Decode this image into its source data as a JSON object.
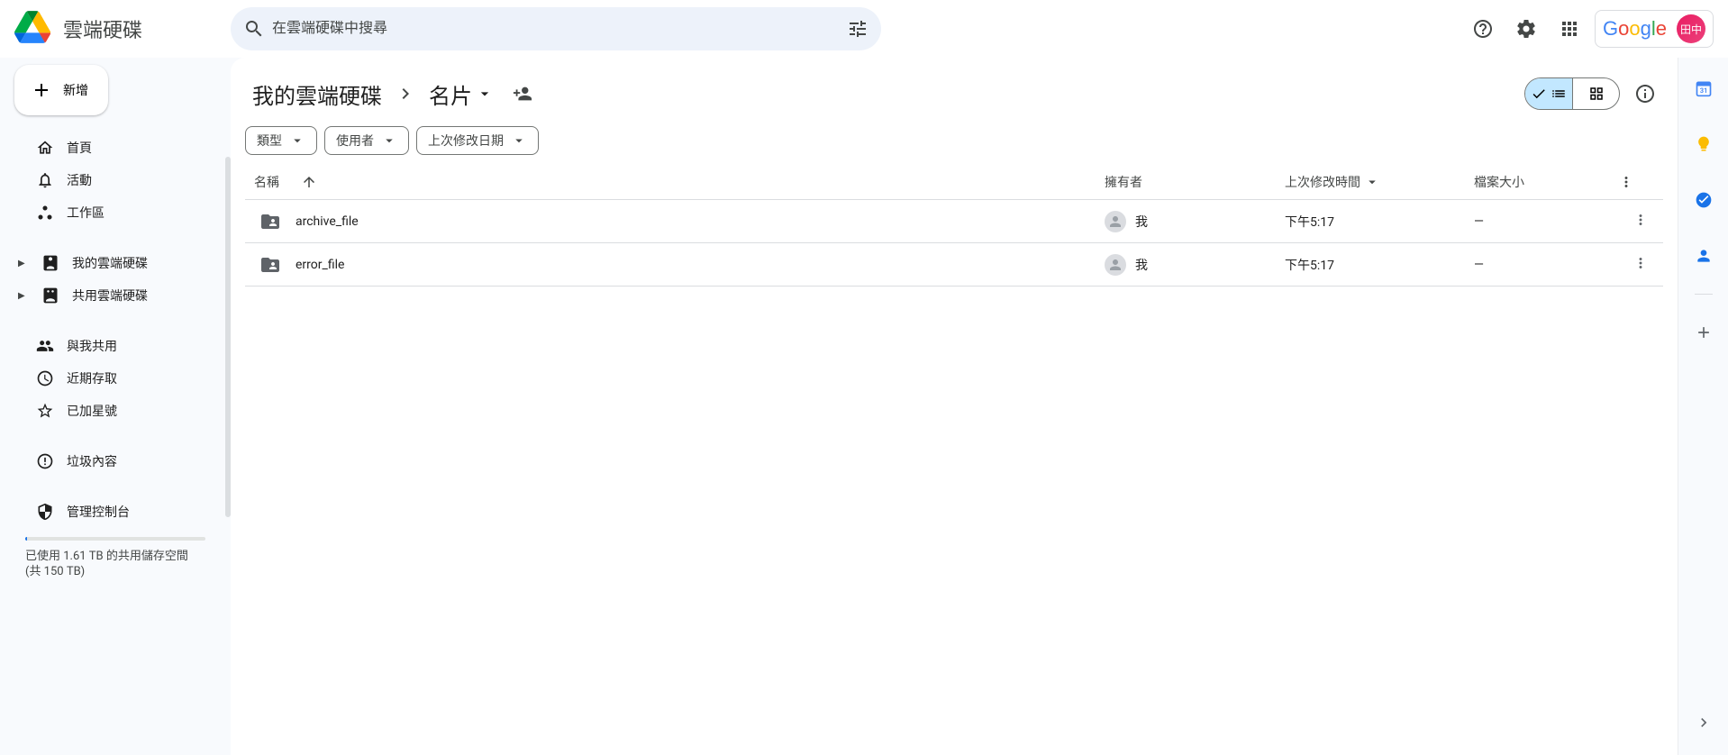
{
  "brand": {
    "title": "雲端硬碟"
  },
  "search": {
    "placeholder": "在雲端硬碟中搜尋"
  },
  "header": {
    "googleText": "Google",
    "avatarInitials": "田中"
  },
  "sidebar": {
    "newLabel": "新增",
    "items": [
      {
        "label": "首頁",
        "icon": "home"
      },
      {
        "label": "活動",
        "icon": "bell"
      },
      {
        "label": "工作區",
        "icon": "workspaces"
      }
    ],
    "drives": [
      {
        "label": "我的雲端硬碟",
        "icon": "mydrive",
        "expand": true
      },
      {
        "label": "共用雲端硬碟",
        "icon": "shareddrive",
        "expand": true
      }
    ],
    "sections": [
      {
        "label": "與我共用",
        "icon": "people"
      },
      {
        "label": "近期存取",
        "icon": "clock"
      },
      {
        "label": "已加星號",
        "icon": "star"
      }
    ],
    "trash": {
      "label": "垃圾內容",
      "icon": "alert"
    },
    "admin": {
      "label": "管理控制台",
      "icon": "admin"
    },
    "storageText": "已使用 1.61 TB 的共用儲存空間 (共 150 TB)"
  },
  "breadcrumb": {
    "root": "我的雲端硬碟",
    "current": "名片"
  },
  "filters": [
    {
      "label": "類型"
    },
    {
      "label": "使用者"
    },
    {
      "label": "上次修改日期"
    }
  ],
  "columns": {
    "name": "名稱",
    "owner": "擁有者",
    "modified": "上次修改時間",
    "size": "檔案大小"
  },
  "rows": [
    {
      "name": "archive_file",
      "owner": "我",
      "modified": "下午5:17",
      "size": "—"
    },
    {
      "name": "error_file",
      "owner": "我",
      "modified": "下午5:17",
      "size": "—"
    }
  ],
  "rail": {
    "calendarDay": "31"
  }
}
